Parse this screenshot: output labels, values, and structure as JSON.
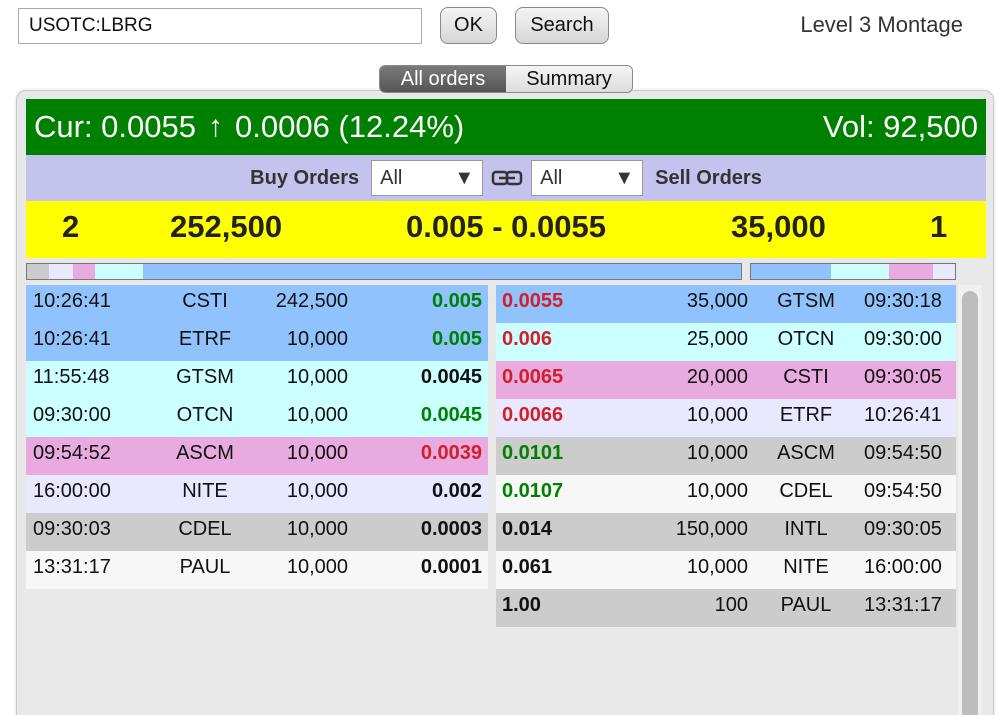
{
  "toolbar": {
    "symbol_value": "USOTC:LBRG",
    "ok_label": "OK",
    "search_label": "Search",
    "page_title": "Level 3 Montage"
  },
  "tabs": [
    {
      "label": "All orders",
      "active": true
    },
    {
      "label": "Summary",
      "active": false
    }
  ],
  "quote": {
    "cur_label": "Cur: 0.0055",
    "change": "0.0006 (12.24%)",
    "volume": "Vol: 92,500",
    "direction_icon": "arrow-up-icon"
  },
  "filters": {
    "buy_label": "Buy Orders",
    "buy_select": "All",
    "sell_select": "All",
    "sell_label": "Sell Orders"
  },
  "summary": {
    "bid_count": "2",
    "bid_size": "252,500",
    "spread": "0.005 - 0.0055",
    "ask_size": "35,000",
    "ask_count": "1"
  },
  "colors": {
    "up_green": "#008000",
    "down_red": "#d0202a",
    "neutral": "#111111",
    "blue": "#90c3fd",
    "cyan": "#ccffff",
    "pink": "#e8aadf",
    "lavender": "#e8e8ff",
    "grey": "#cccccc",
    "light": "#f7f7f7"
  },
  "buy_orders": [
    {
      "time": "10:26:41",
      "mm": "CSTI",
      "size": "242,500",
      "price": "0.005",
      "price_color": "up_green",
      "row_color": "blue"
    },
    {
      "time": "10:26:41",
      "mm": "ETRF",
      "size": "10,000",
      "price": "0.005",
      "price_color": "up_green",
      "row_color": "blue"
    },
    {
      "time": "11:55:48",
      "mm": "GTSM",
      "size": "10,000",
      "price": "0.0045",
      "price_color": "neutral",
      "row_color": "cyan"
    },
    {
      "time": "09:30:00",
      "mm": "OTCN",
      "size": "10,000",
      "price": "0.0045",
      "price_color": "up_green",
      "row_color": "cyan"
    },
    {
      "time": "09:54:52",
      "mm": "ASCM",
      "size": "10,000",
      "price": "0.0039",
      "price_color": "down_red",
      "row_color": "pink"
    },
    {
      "time": "16:00:00",
      "mm": "NITE",
      "size": "10,000",
      "price": "0.002",
      "price_color": "neutral",
      "row_color": "lavender"
    },
    {
      "time": "09:30:03",
      "mm": "CDEL",
      "size": "10,000",
      "price": "0.0003",
      "price_color": "neutral",
      "row_color": "grey"
    },
    {
      "time": "13:31:17",
      "mm": "PAUL",
      "size": "10,000",
      "price": "0.0001",
      "price_color": "neutral",
      "row_color": "light"
    }
  ],
  "sell_orders": [
    {
      "price": "0.0055",
      "price_color": "down_red",
      "size": "35,000",
      "mm": "GTSM",
      "time": "09:30:18",
      "row_color": "blue"
    },
    {
      "price": "0.006",
      "price_color": "down_red",
      "size": "25,000",
      "mm": "OTCN",
      "time": "09:30:00",
      "row_color": "cyan"
    },
    {
      "price": "0.0065",
      "price_color": "down_red",
      "size": "20,000",
      "mm": "CSTI",
      "time": "09:30:05",
      "row_color": "pink"
    },
    {
      "price": "0.0066",
      "price_color": "down_red",
      "size": "10,000",
      "mm": "ETRF",
      "time": "10:26:41",
      "row_color": "lavender"
    },
    {
      "price": "0.0101",
      "price_color": "up_green",
      "size": "10,000",
      "mm": "ASCM",
      "time": "09:54:50",
      "row_color": "grey"
    },
    {
      "price": "0.0107",
      "price_color": "up_green",
      "size": "10,000",
      "mm": "CDEL",
      "time": "09:54:50",
      "row_color": "light"
    },
    {
      "price": "0.014",
      "price_color": "neutral",
      "size": "150,000",
      "mm": "INTL",
      "time": "09:30:05",
      "row_color": "grey"
    },
    {
      "price": "0.061",
      "price_color": "neutral",
      "size": "10,000",
      "mm": "NITE",
      "time": "16:00:00",
      "row_color": "light"
    },
    {
      "price": "1.00",
      "price_color": "neutral",
      "size": "100",
      "mm": "PAUL",
      "time": "13:31:17",
      "row_color": "grey"
    }
  ]
}
